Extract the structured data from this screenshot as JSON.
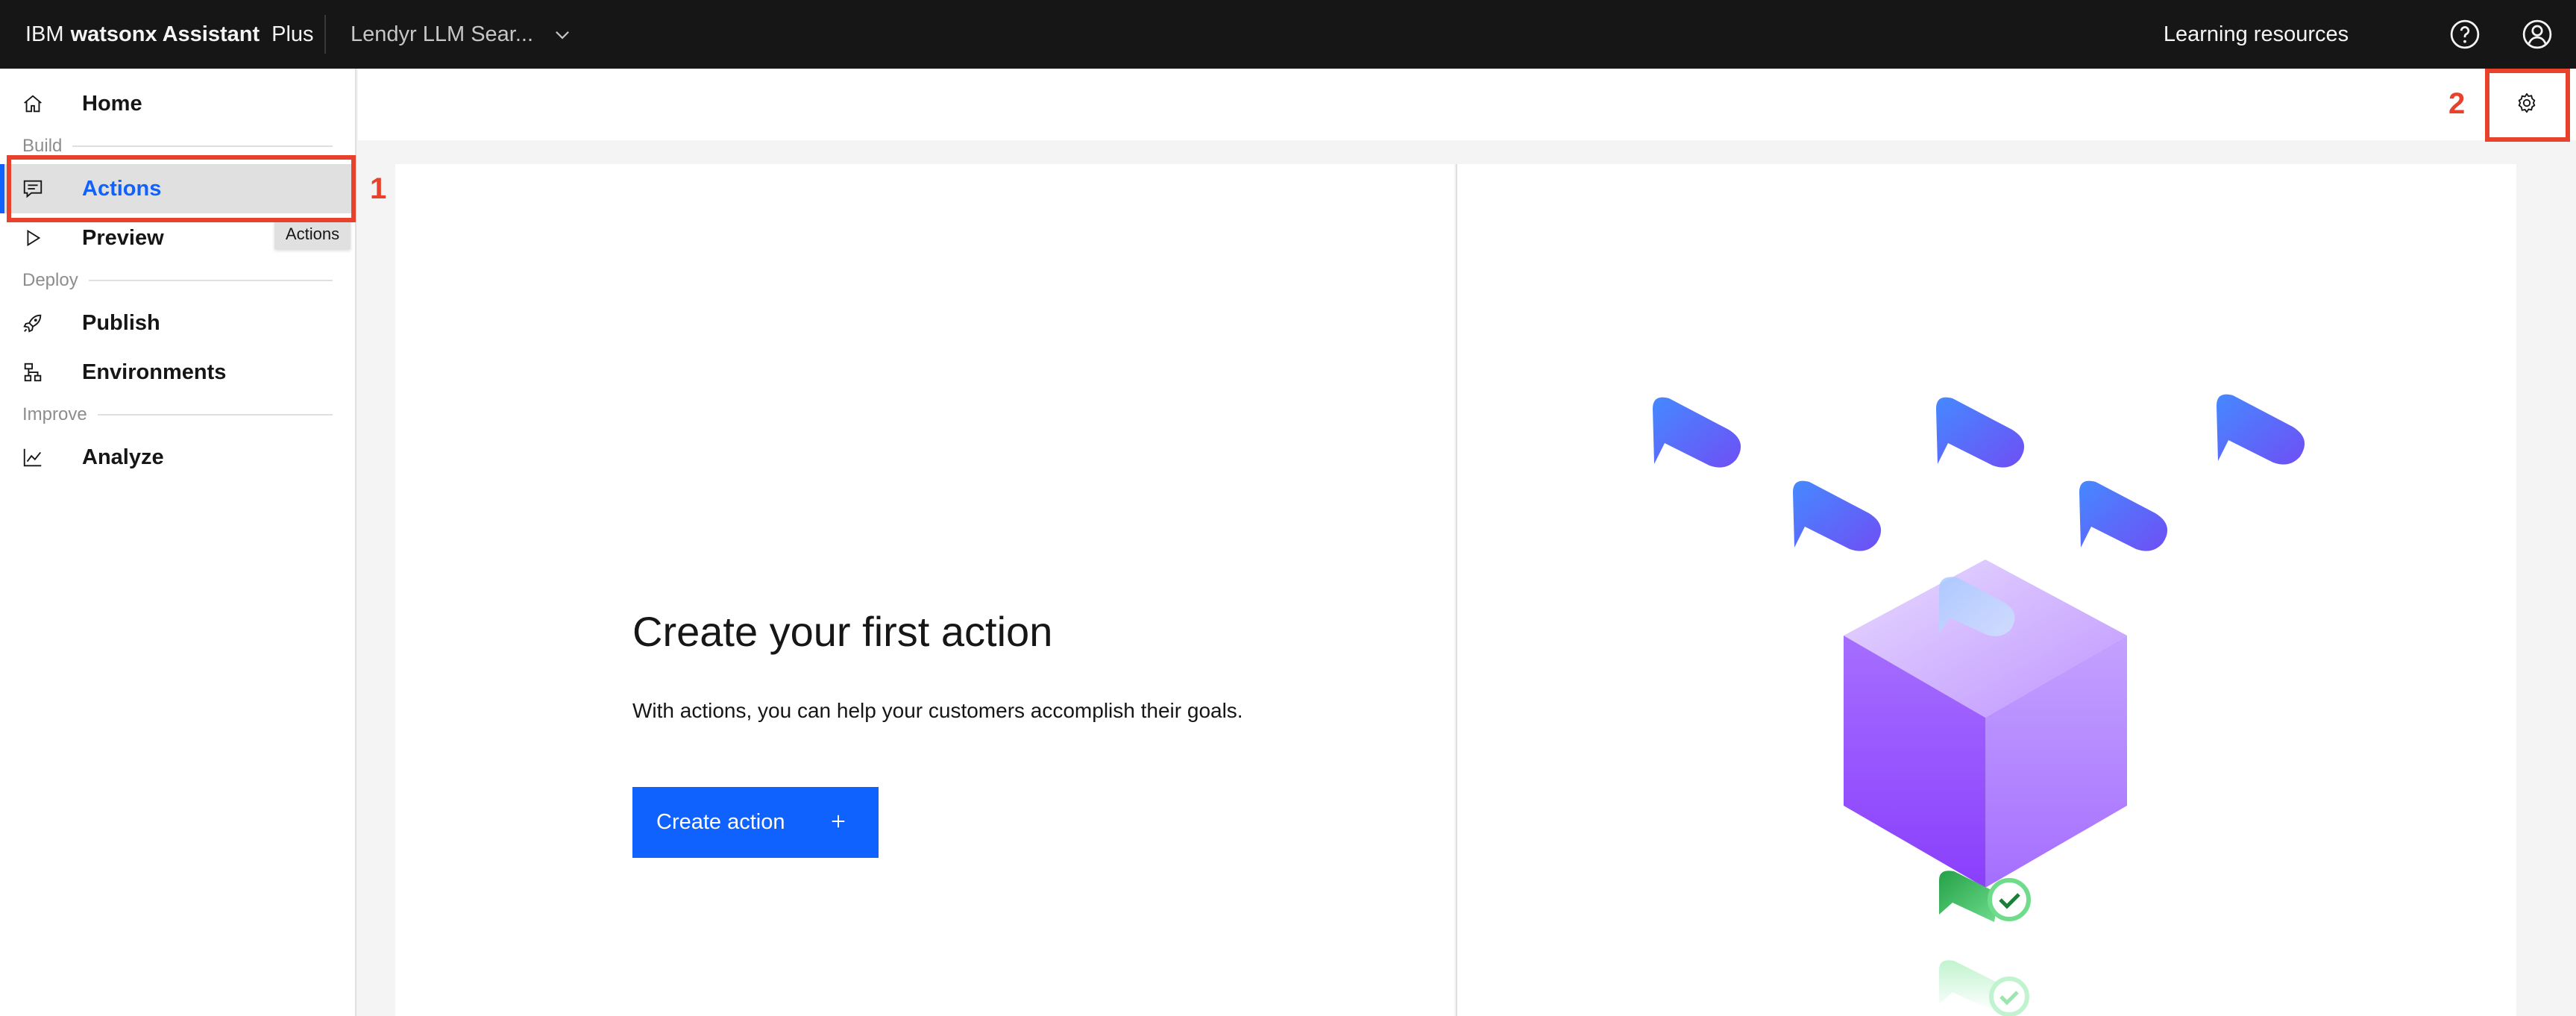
{
  "header": {
    "brand_prefix": "IBM",
    "brand_name": "watsonx Assistant",
    "plan": "Plus",
    "project": "Lendyr LLM Sear...",
    "learning_resources": "Learning resources",
    "icons": [
      "chevron-down-icon",
      "help-icon",
      "user-avatar-icon"
    ]
  },
  "sidebar": {
    "home": "Home",
    "sections": {
      "build": "Build",
      "deploy": "Deploy",
      "improve": "Improve"
    },
    "items": {
      "actions": "Actions",
      "preview": "Preview",
      "publish": "Publish",
      "environments": "Environments",
      "analyze": "Analyze"
    },
    "active": "Actions",
    "tooltip": "Actions"
  },
  "annotations": {
    "one": "1",
    "two": "2",
    "color": "#e8412c"
  },
  "main": {
    "title": "Create your first action",
    "description": "With actions, you can help your customers accomplish their goals.",
    "create_button": "Create action",
    "settings_icon": "gear-icon"
  },
  "colors": {
    "accent": "#0f62fe",
    "header_bg": "#161616",
    "illustration_cube": "#a56eff"
  }
}
